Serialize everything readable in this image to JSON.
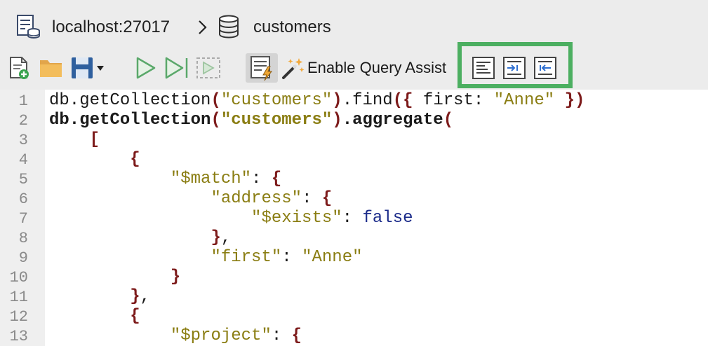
{
  "breadcrumb": {
    "host": "localhost:27017",
    "separator": ">",
    "collection": "customers",
    "server_icon": "server-icon",
    "database_icon": "database-icon"
  },
  "toolbar": {
    "new_icon": "new-file-icon",
    "open_icon": "open-folder-icon",
    "save_icon": "save-icon",
    "run_icon": "run-icon",
    "run_line_icon": "run-current-line-icon",
    "run_selection_icon": "run-selection-icon",
    "query_profiler_icon": "query-profiler-icon",
    "assist_icon": "magic-wand-icon",
    "enable_query_assist": "Enable Query Assist",
    "format_icon": "format-document-icon",
    "indent_icon": "indent-icon",
    "outdent_icon": "outdent-icon"
  },
  "editor": {
    "lines": [
      {
        "n": "1",
        "text": "db.getCollection(\"customers\").find({ first: \"Anne\" })"
      },
      {
        "n": "2",
        "text": "db.getCollection(\"customers\").aggregate("
      },
      {
        "n": "3",
        "text": "    ["
      },
      {
        "n": "4",
        "text": "        {"
      },
      {
        "n": "5",
        "text": "            \"$match\": {"
      },
      {
        "n": "6",
        "text": "                \"address\": {"
      },
      {
        "n": "7",
        "text": "                    \"$exists\": false"
      },
      {
        "n": "8",
        "text": "                },"
      },
      {
        "n": "9",
        "text": "                \"first\": \"Anne\""
      },
      {
        "n": "10",
        "text": "            }"
      },
      {
        "n": "11",
        "text": "        },"
      },
      {
        "n": "12",
        "text": "        {"
      },
      {
        "n": "13",
        "text": "            \"$project\": {"
      }
    ]
  },
  "colors": {
    "highlight_box": "#4caf61",
    "string": "#8a7d12",
    "bracket": "#7d1b1b",
    "keyword": "#1b2b8a"
  }
}
